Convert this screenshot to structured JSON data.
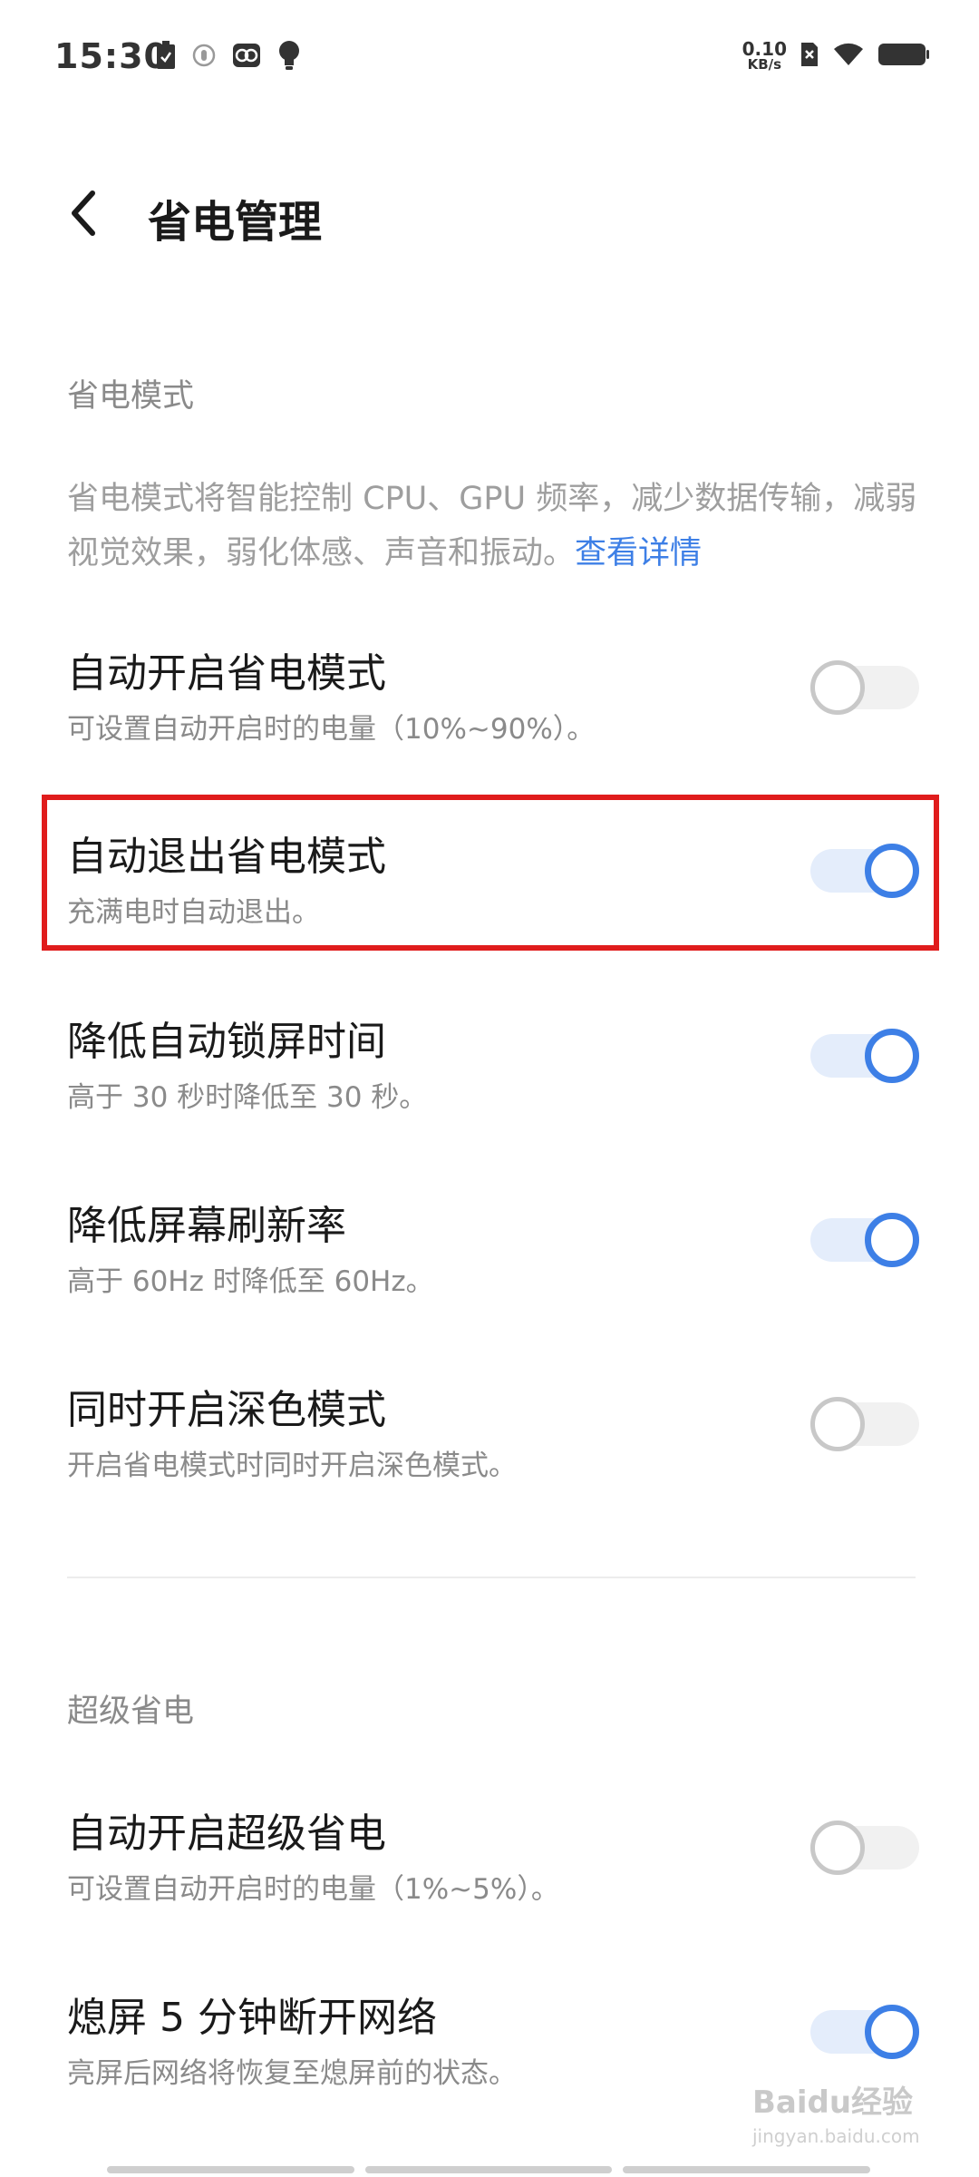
{
  "status_bar": {
    "time": "15:30",
    "net_speed_value": "0.10",
    "net_speed_unit": "KB/s",
    "left_icons": [
      "battery-saver-icon",
      "vpn-icon",
      "app-notification-icon",
      "bulb-icon"
    ],
    "right_icons": [
      "no-sim-icon",
      "wifi-icon",
      "battery-icon"
    ]
  },
  "header": {
    "back_icon": "chevron-left-icon",
    "title": "省电管理"
  },
  "sections": {
    "power_saving": {
      "title": "省电模式",
      "description": "省电模式将智能控制 CPU、GPU 频率，减少数据传输，减弱视觉效果，弱化体感、声音和振动。",
      "link": "查看详情"
    },
    "super_saving": {
      "title": "超级省电"
    }
  },
  "settings": [
    {
      "title": "自动开启省电模式",
      "subtitle": "可设置自动开启时的电量（10%~90%）。",
      "enabled": false
    },
    {
      "title": "自动退出省电模式",
      "subtitle": "充满电时自动退出。",
      "enabled": true
    },
    {
      "title": "降低自动锁屏时间",
      "subtitle": "高于 30 秒时降低至 30 秒。",
      "enabled": true
    },
    {
      "title": "降低屏幕刷新率",
      "subtitle": "高于 60Hz 时降低至 60Hz。",
      "enabled": true
    },
    {
      "title": "同时开启深色模式",
      "subtitle": "开启省电模式时同时开启深色模式。",
      "enabled": false
    },
    {
      "title": "自动开启超级省电",
      "subtitle": "可设置自动开启时的电量（1%~5%）。",
      "enabled": false
    },
    {
      "title": "熄屏 5 分钟断开网络",
      "subtitle": "亮屏后网络将恢复至熄屏前的状态。",
      "enabled": true
    }
  ],
  "colors": {
    "accent": "#3d7fe6",
    "highlight_border": "#e01c1c"
  },
  "watermark": {
    "brand": "Baidu经验",
    "url": "jingyan.baidu.com"
  }
}
